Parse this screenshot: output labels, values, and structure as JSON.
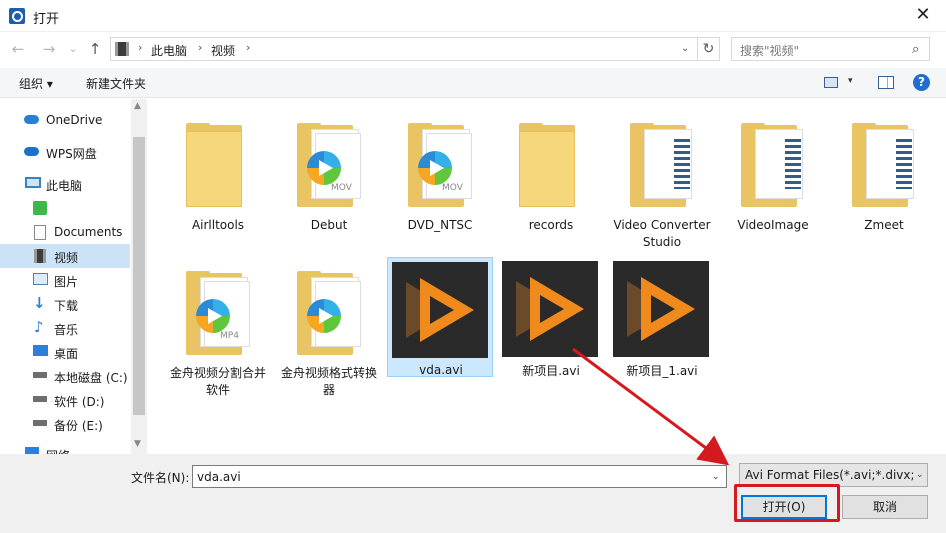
{
  "window": {
    "title": "打开",
    "close_symbol": "✕"
  },
  "nav": {
    "back": "←",
    "forward": "→",
    "recent": "⌄",
    "up": "↑",
    "breadcrumb": [
      "此电脑",
      "视频"
    ],
    "separator": "›",
    "dropdown": "⌄",
    "refresh": "↻",
    "search_placeholder": "搜索\"视频\"",
    "search_icon": "⌕"
  },
  "toolbar": {
    "organize": "组织 ▾",
    "new_folder": "新建文件夹",
    "view_drop": "▾",
    "help": "?"
  },
  "sidebar": {
    "items": [
      {
        "label": "OneDrive",
        "icon": "cloud-icon"
      },
      {
        "label": "WPS网盘",
        "icon": "wps-cloud-icon"
      },
      {
        "label": "此电脑",
        "icon": "computer-icon"
      },
      {
        "label": "",
        "icon": "green-app-icon"
      },
      {
        "label": "Documents",
        "icon": "documents-icon"
      },
      {
        "label": "视频",
        "icon": "video-icon"
      },
      {
        "label": "图片",
        "icon": "pictures-icon"
      },
      {
        "label": "下载",
        "icon": "download-icon"
      },
      {
        "label": "音乐",
        "icon": "music-icon"
      },
      {
        "label": "桌面",
        "icon": "desktop-icon"
      },
      {
        "label": "本地磁盘 (C:)",
        "icon": "drive-icon"
      },
      {
        "label": "软件 (D:)",
        "icon": "drive-icon"
      },
      {
        "label": "备份 (E:)",
        "icon": "drive-icon"
      },
      {
        "label": "网络",
        "icon": "network-icon"
      }
    ],
    "scroll_up": "▲",
    "scroll_down": "▼"
  },
  "files": [
    {
      "name": "Airlltools",
      "kind": "folder"
    },
    {
      "name": "Debut",
      "kind": "folder-media",
      "ext": "MOV"
    },
    {
      "name": "DVD_NTSC",
      "kind": "folder-media",
      "ext": "MOV"
    },
    {
      "name": "records",
      "kind": "folder"
    },
    {
      "name": "Video Converter Studio",
      "kind": "folder-doc"
    },
    {
      "name": "VideoImage",
      "kind": "folder-doc"
    },
    {
      "name": "Zmeet",
      "kind": "folder-doc"
    },
    {
      "name": "金舟视频分割合并软件",
      "kind": "folder-media",
      "ext": "MP4"
    },
    {
      "name": "金舟视频格式转换器",
      "kind": "folder-media",
      "ext": ""
    },
    {
      "name": "vda.avi",
      "kind": "video",
      "selected": true
    },
    {
      "name": "新项目.avi",
      "kind": "video"
    },
    {
      "name": "新项目_1.avi",
      "kind": "video"
    }
  ],
  "bottom": {
    "filename_label": "文件名(N):",
    "filename_value": "vda.avi",
    "dropdown": "⌄",
    "file_type": "Avi Format Files(*.avi;*.divx;*.",
    "open_button": "打开(O)",
    "cancel_button": "取消"
  },
  "colors": {
    "accent": "#0078d7",
    "selection": "#cce8ff",
    "annotation_red": "#d4191f"
  }
}
